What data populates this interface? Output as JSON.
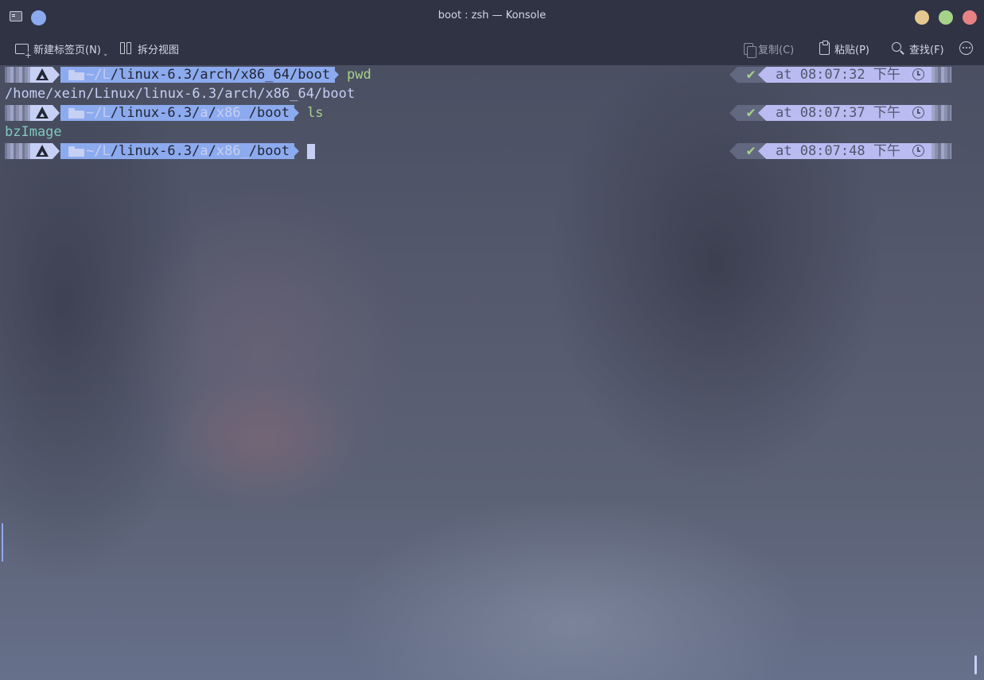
{
  "window": {
    "title": "boot : zsh — Konsole",
    "colors": {
      "min": "#e5c890",
      "max": "#a6d189",
      "close": "#e78284",
      "pin": "#8caaee"
    }
  },
  "toolbar": {
    "new_tab": "新建标签页(N)",
    "split_view": "拆分视图",
    "copy": "复制(C)",
    "paste": "粘贴(P)",
    "find": "查找(F)"
  },
  "terminal": {
    "lines": [
      {
        "type": "prompt",
        "path": {
          "home": "~/",
          "l": "L",
          "rest_a": "/linux-6.3/",
          "mid": "arch",
          "sep": "/",
          "mid2": "x86_64",
          "tail": "/boot"
        },
        "command": "pwd",
        "time": "at 08:07:32 下午",
        "status": "✔"
      },
      {
        "type": "output",
        "text": "/home/xein/Linux/linux-6.3/arch/x86_64/boot"
      },
      {
        "type": "prompt",
        "path": {
          "home": "~/",
          "l": "L",
          "rest_a": "/linux-6.3/",
          "mid": "a",
          "sep": "/",
          "mid2": "x86_",
          "tail": "/boot"
        },
        "command": "ls",
        "time": "at 08:07:37 下午",
        "status": "✔"
      },
      {
        "type": "output",
        "text": "bzImage"
      },
      {
        "type": "prompt",
        "path": {
          "home": "~/",
          "l": "L",
          "rest_a": "/linux-6.3/",
          "mid": "a",
          "sep": "/",
          "mid2": "x86_",
          "tail": "/boot"
        },
        "command": "",
        "time": "at 08:07:48 下午",
        "status": "✔"
      }
    ]
  }
}
